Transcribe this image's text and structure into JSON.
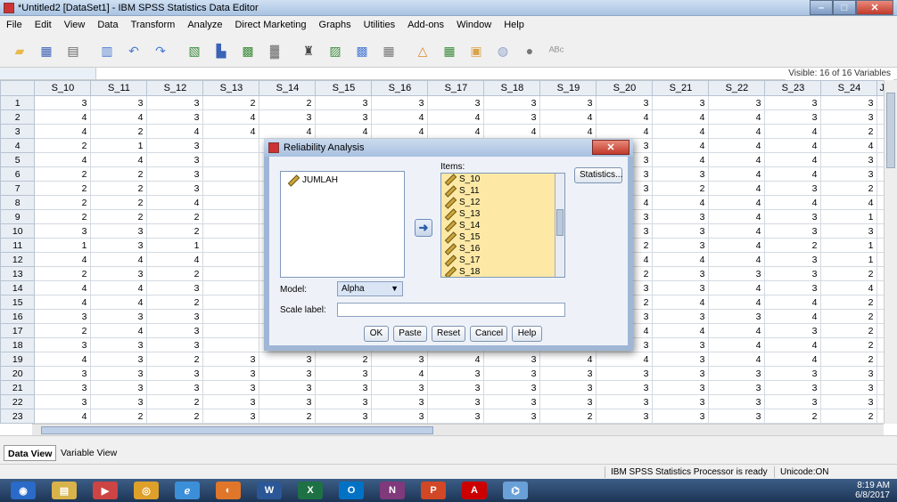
{
  "window": {
    "title": "*Untitled2 [DataSet1] - IBM SPSS Statistics Data Editor",
    "min": "–",
    "max": "□",
    "close": "✕"
  },
  "menu": [
    "File",
    "Edit",
    "View",
    "Data",
    "Transform",
    "Analyze",
    "Direct Marketing",
    "Graphs",
    "Utilities",
    "Add-ons",
    "Window",
    "Help"
  ],
  "toolbar_icons": [
    "open-icon",
    "save-icon",
    "print-icon",
    "dialog-recall-icon",
    "undo-icon",
    "redo-icon",
    "goto-case-icon",
    "goto-variable-icon",
    "variables-icon",
    "run-descriptives-icon",
    "find-icon",
    "insert-cases-icon",
    "insert-variable-icon",
    "split-file-icon",
    "weight-cases-icon",
    "select-cases-icon",
    "value-labels-icon",
    "use-sets-icon",
    "show-all-icon",
    "spell-check-icon"
  ],
  "visible_vars": "Visible: 16 of 16 Variables",
  "grid": {
    "columns": [
      "S_10",
      "S_11",
      "S_12",
      "S_13",
      "S_14",
      "S_15",
      "S_16",
      "S_17",
      "S_18",
      "S_19",
      "S_20",
      "S_21",
      "S_22",
      "S_23",
      "S_24",
      "JUI"
    ],
    "rows": [
      [
        "1",
        "3",
        "3",
        "3",
        "2",
        "2",
        "3",
        "3",
        "3",
        "3",
        "3",
        "3",
        "3",
        "3",
        "3",
        "3",
        ""
      ],
      [
        "2",
        "4",
        "4",
        "3",
        "4",
        "3",
        "3",
        "4",
        "4",
        "3",
        "4",
        "4",
        "4",
        "4",
        "3",
        "3",
        ""
      ],
      [
        "3",
        "4",
        "2",
        "4",
        "4",
        "4",
        "4",
        "4",
        "4",
        "4",
        "4",
        "4",
        "4",
        "4",
        "4",
        "2",
        ""
      ],
      [
        "4",
        "2",
        "1",
        "3",
        "",
        "",
        "",
        "",
        "",
        "",
        "",
        "3",
        "4",
        "4",
        "4",
        "4",
        ""
      ],
      [
        "5",
        "4",
        "4",
        "3",
        "",
        "",
        "",
        "",
        "",
        "",
        "",
        "3",
        "4",
        "4",
        "4",
        "3",
        ""
      ],
      [
        "6",
        "2",
        "2",
        "3",
        "",
        "",
        "",
        "",
        "",
        "",
        "",
        "3",
        "3",
        "4",
        "4",
        "3",
        ""
      ],
      [
        "7",
        "2",
        "2",
        "3",
        "",
        "",
        "",
        "",
        "",
        "",
        "",
        "3",
        "2",
        "4",
        "3",
        "2",
        ""
      ],
      [
        "8",
        "2",
        "2",
        "4",
        "",
        "",
        "",
        "",
        "",
        "",
        "",
        "4",
        "4",
        "4",
        "4",
        "4",
        ""
      ],
      [
        "9",
        "2",
        "2",
        "2",
        "",
        "",
        "",
        "",
        "",
        "",
        "",
        "3",
        "3",
        "4",
        "3",
        "1",
        ""
      ],
      [
        "10",
        "3",
        "3",
        "2",
        "",
        "",
        "",
        "",
        "",
        "",
        "",
        "3",
        "3",
        "4",
        "3",
        "3",
        ""
      ],
      [
        "11",
        "1",
        "3",
        "1",
        "",
        "",
        "",
        "",
        "",
        "",
        "",
        "2",
        "3",
        "4",
        "2",
        "1",
        ""
      ],
      [
        "12",
        "4",
        "4",
        "4",
        "",
        "",
        "",
        "",
        "",
        "",
        "",
        "4",
        "4",
        "4",
        "3",
        "1",
        ""
      ],
      [
        "13",
        "2",
        "3",
        "2",
        "",
        "",
        "",
        "",
        "",
        "",
        "",
        "2",
        "3",
        "3",
        "3",
        "2",
        ""
      ],
      [
        "14",
        "4",
        "4",
        "3",
        "",
        "",
        "",
        "",
        "",
        "",
        "",
        "3",
        "3",
        "4",
        "3",
        "4",
        ""
      ],
      [
        "15",
        "4",
        "4",
        "2",
        "",
        "",
        "",
        "",
        "",
        "",
        "",
        "2",
        "4",
        "4",
        "4",
        "2",
        ""
      ],
      [
        "16",
        "3",
        "3",
        "3",
        "",
        "",
        "",
        "",
        "",
        "",
        "",
        "3",
        "3",
        "3",
        "4",
        "2",
        ""
      ],
      [
        "17",
        "2",
        "4",
        "3",
        "",
        "",
        "",
        "",
        "",
        "",
        "",
        "4",
        "4",
        "4",
        "3",
        "2",
        ""
      ],
      [
        "18",
        "3",
        "3",
        "3",
        "",
        "",
        "",
        "",
        "",
        "",
        "",
        "3",
        "3",
        "4",
        "4",
        "2",
        ""
      ],
      [
        "19",
        "4",
        "3",
        "2",
        "3",
        "3",
        "2",
        "3",
        "4",
        "3",
        "4",
        "4",
        "3",
        "4",
        "4",
        "2",
        ""
      ],
      [
        "20",
        "3",
        "3",
        "3",
        "3",
        "3",
        "3",
        "4",
        "3",
        "3",
        "3",
        "3",
        "3",
        "3",
        "3",
        "3",
        ""
      ],
      [
        "21",
        "3",
        "3",
        "3",
        "3",
        "3",
        "3",
        "3",
        "3",
        "3",
        "3",
        "3",
        "3",
        "3",
        "3",
        "3",
        ""
      ],
      [
        "22",
        "3",
        "3",
        "2",
        "3",
        "3",
        "3",
        "3",
        "3",
        "3",
        "3",
        "3",
        "3",
        "3",
        "3",
        "3",
        ""
      ],
      [
        "23",
        "4",
        "2",
        "2",
        "3",
        "2",
        "3",
        "3",
        "3",
        "3",
        "2",
        "3",
        "3",
        "3",
        "2",
        "2",
        ""
      ]
    ]
  },
  "view_tabs": [
    "Data View",
    "Variable View"
  ],
  "status": {
    "processor": "IBM SPSS Statistics Processor is ready",
    "unicode": "Unicode:ON"
  },
  "taskbar": {
    "apps": [
      "start-button",
      "file-explorer-icon",
      "media-player-icon",
      "chrome-icon",
      "ie-icon",
      "firefox-icon",
      "word-icon",
      "excel-icon",
      "outlook-icon",
      "onenote-icon",
      "powerpoint-icon",
      "acrobat-icon",
      "spss-icon"
    ],
    "time": "8:19 AM",
    "date": "6/8/2017"
  },
  "dialog": {
    "title": "Reliability Analysis",
    "variables": [
      "JUMLAH"
    ],
    "items_label": "Items:",
    "items": [
      "S_10",
      "S_11",
      "S_12",
      "S_13",
      "S_14",
      "S_15",
      "S_16",
      "S_17",
      "S_18"
    ],
    "statistics_btn": "Statistics...",
    "model_label": "Model:",
    "model_value": "Alpha",
    "scale_label": "Scale label:",
    "scale_value": "",
    "buttons": [
      "OK",
      "Paste",
      "Reset",
      "Cancel",
      "Help"
    ]
  }
}
